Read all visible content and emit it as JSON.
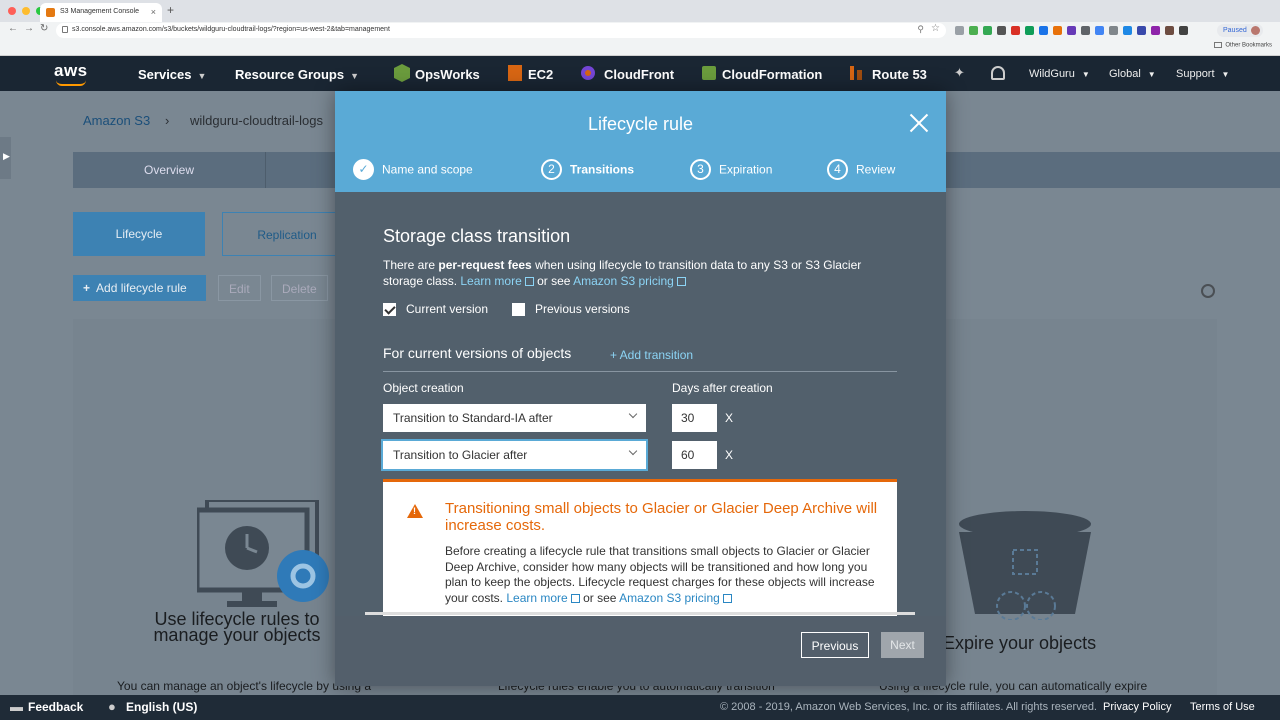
{
  "browser": {
    "tab_title": "S3 Management Console",
    "url": "s3.console.aws.amazon.com/s3/buckets/wildguru-cloudtrail-logs/?region=us-west-2&tab=management",
    "paused_label": "Paused",
    "bookmarks_label": "Other Bookmarks"
  },
  "awsnav": {
    "logo": "aws",
    "services": "Services",
    "resource_groups": "Resource Groups",
    "opsworks": "OpsWorks",
    "ec2": "EC2",
    "cloudfront": "CloudFront",
    "cloudformation": "CloudFormation",
    "route53": "Route 53",
    "account": "WildGuru",
    "region": "Global",
    "support": "Support"
  },
  "page": {
    "breadcrumb_root": "Amazon S3",
    "breadcrumb_bucket": "wildguru-cloudtrail-logs",
    "tab_overview": "Overview",
    "subtab_lifecycle": "Lifecycle",
    "subtab_replication": "Replication",
    "add_rule": "Add lifecycle rule",
    "edit": "Edit",
    "delete": "Delete",
    "hero_left": "Use lifecycle rules to manage your objects",
    "hero_right": "Expire your objects",
    "desc_left": "You can manage an object's lifecycle by using a",
    "desc_mid": "Lifecycle rules enable you to automatically transition",
    "desc_right": "Using a lifecycle rule, you can automatically expire"
  },
  "modal": {
    "title": "Lifecycle rule",
    "steps": [
      {
        "num": "✓",
        "label": "Name and scope"
      },
      {
        "num": "2",
        "label": "Transitions"
      },
      {
        "num": "3",
        "label": "Expiration"
      },
      {
        "num": "4",
        "label": "Review"
      }
    ],
    "section_title": "Storage class transition",
    "intro_pre": "There are ",
    "intro_bold": "per-request fees",
    "intro_post": " when using lifecycle to transition data to any S3 or S3 Glacier storage class. ",
    "learn_more": "Learn more",
    "or_see": " or see ",
    "pricing": "Amazon S3 pricing",
    "current_version": "Current version",
    "previous_versions": "Previous versions",
    "for_current": "For current versions of objects",
    "add_transition": "+ Add transition",
    "col_object": "Object creation",
    "col_days": "Days after creation",
    "transitions": [
      {
        "label": "Transition to Standard-IA after",
        "days": "30"
      },
      {
        "label": "Transition to Glacier after",
        "days": "60"
      }
    ],
    "remove_label": "X",
    "warning_title": "Transitioning small objects to Glacier or Glacier Deep Archive will increase costs.",
    "warning_text": "Before creating a lifecycle rule that transitions small objects to Glacier or Glacier Deep Archive, consider how many objects will be transitioned and how long you plan to keep the objects. Lifecycle request charges for these objects will increase your costs. ",
    "previous": "Previous",
    "next": "Next"
  },
  "footer": {
    "feedback": "Feedback",
    "language": "English (US)",
    "copyright": "© 2008 - 2019, Amazon Web Services, Inc. or its affiliates. All rights reserved.",
    "privacy": "Privacy Policy",
    "terms": "Terms of Use"
  },
  "colors": {
    "modal_header": "#5aaad6",
    "warning": "#e5680a",
    "aws_nav": "#1a2633"
  }
}
